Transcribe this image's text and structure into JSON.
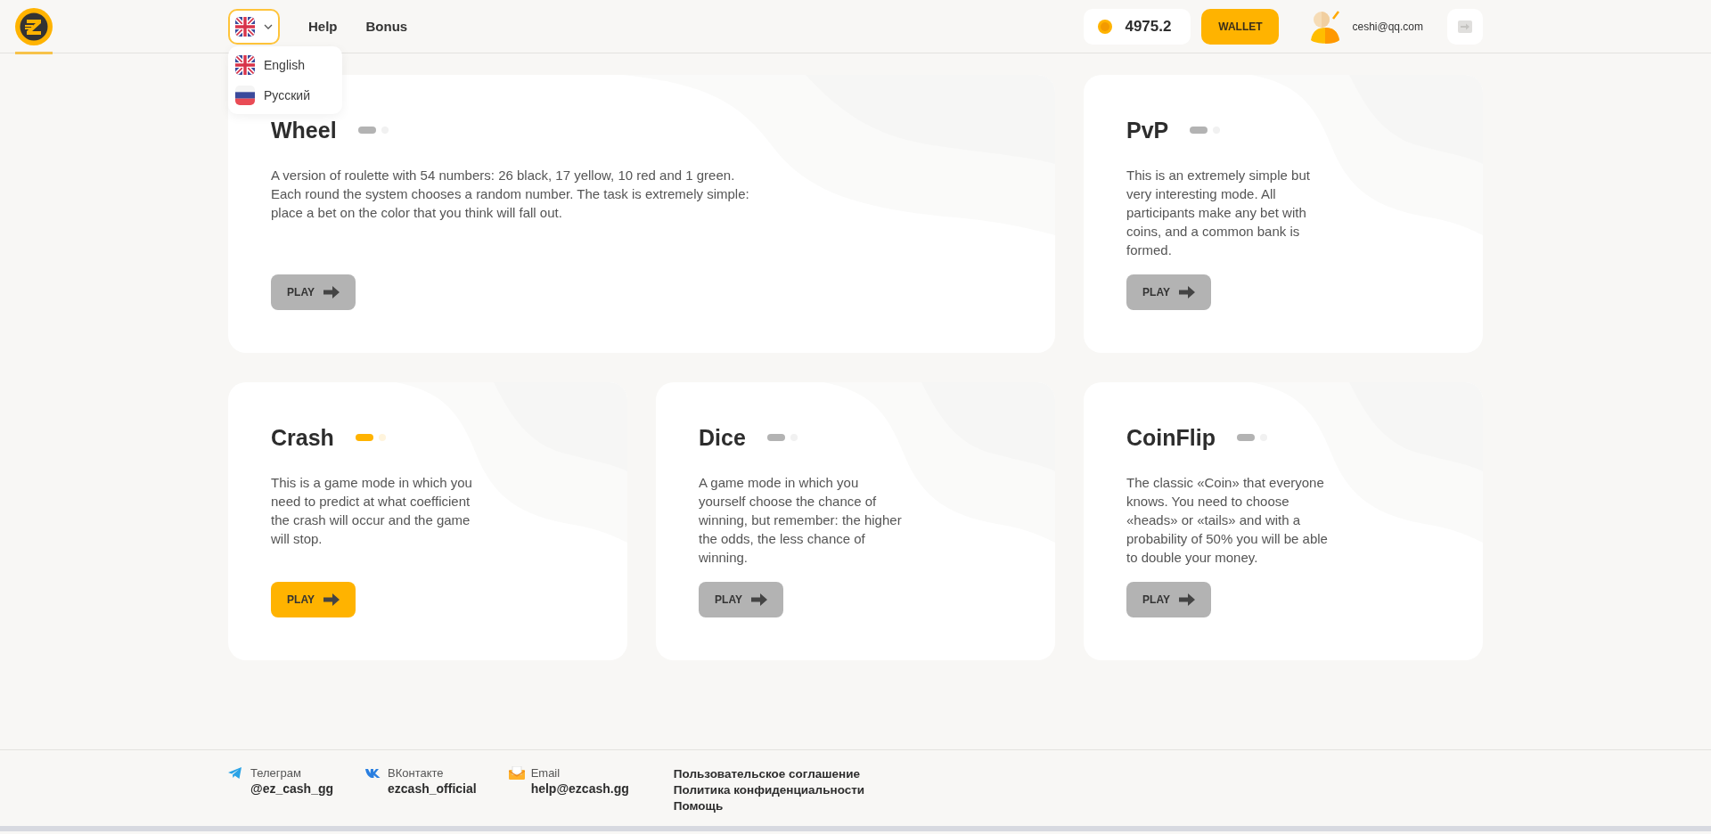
{
  "header": {
    "nav": [
      "Help",
      "Bonus"
    ],
    "language": {
      "expanded": true,
      "options": [
        {
          "label": "English",
          "kind": "uk"
        },
        {
          "label": "Русский",
          "kind": "ru"
        }
      ]
    },
    "balance": "4975.2",
    "wallet_button": "WALLET",
    "user_email": "ceshi@qq.com"
  },
  "games": [
    {
      "title": "Wheel",
      "kind": "wide",
      "active": false,
      "description": "A version of roulette with 54 numbers: 26 black, 17 yellow, 10 red and 1 green. Each round the system chooses a random number. The task is extremely simple: place a bet on the color that you think will fall out.",
      "button": "PLAY"
    },
    {
      "title": "PvP",
      "kind": "normal",
      "active": false,
      "description": "This is an extremely simple but very interesting mode. All participants make any bet with coins, and a common bank is formed.",
      "button": "PLAY"
    },
    {
      "title": "Crash",
      "kind": "normal",
      "active": true,
      "description": "This is a game mode in which you need to predict at what coefficient the crash will occur and the game will stop.",
      "button": "PLAY"
    },
    {
      "title": "Dice",
      "kind": "normal",
      "active": false,
      "description": "A game mode in which you yourself choose the chance of winning, but remember: the higher the odds, the less chance of winning.",
      "button": "PLAY"
    },
    {
      "title": "CoinFlip",
      "kind": "normal",
      "active": false,
      "description": "The classic «Coin» that everyone knows. You need to choose «heads» or «tails» and with a probability of 50% you will be able to double your money.",
      "button": "PLAY"
    }
  ],
  "footer": {
    "contacts": [
      {
        "kind": "telegram",
        "label": "Телеграм",
        "value": "@ez_cash_gg"
      },
      {
        "kind": "vk",
        "label": "ВКонтакте",
        "value": "ezcash_official"
      },
      {
        "kind": "email",
        "label": "Email",
        "value": "help@ezcash.gg"
      }
    ],
    "links": [
      "Пользовательское соглашение",
      "Политика конфиденциальности",
      "Помощь"
    ]
  }
}
